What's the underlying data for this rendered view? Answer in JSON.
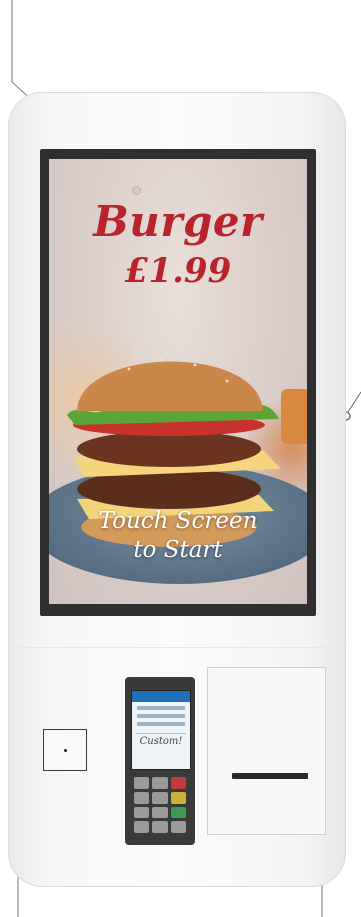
{
  "promo": {
    "title": "Burger",
    "price": "£1.99",
    "call_to_action_line1": "Touch Screen",
    "call_to_action_line2": "to Start"
  },
  "colors": {
    "promo_text": "#b8242e",
    "call_to_action_text": "#ffffff",
    "kiosk_body": "#f6f6f7",
    "bezel": "#2f2f2f",
    "terminal_body": "#3a3a3a",
    "terminal_screen_header": "#1d6fb8"
  },
  "terminal": {
    "signature_text": "Custom!"
  },
  "icons": {
    "scanner": "barcode-scanner-icon",
    "camera": "camera-dot-icon",
    "callout_marker": "circle-marker-icon"
  }
}
